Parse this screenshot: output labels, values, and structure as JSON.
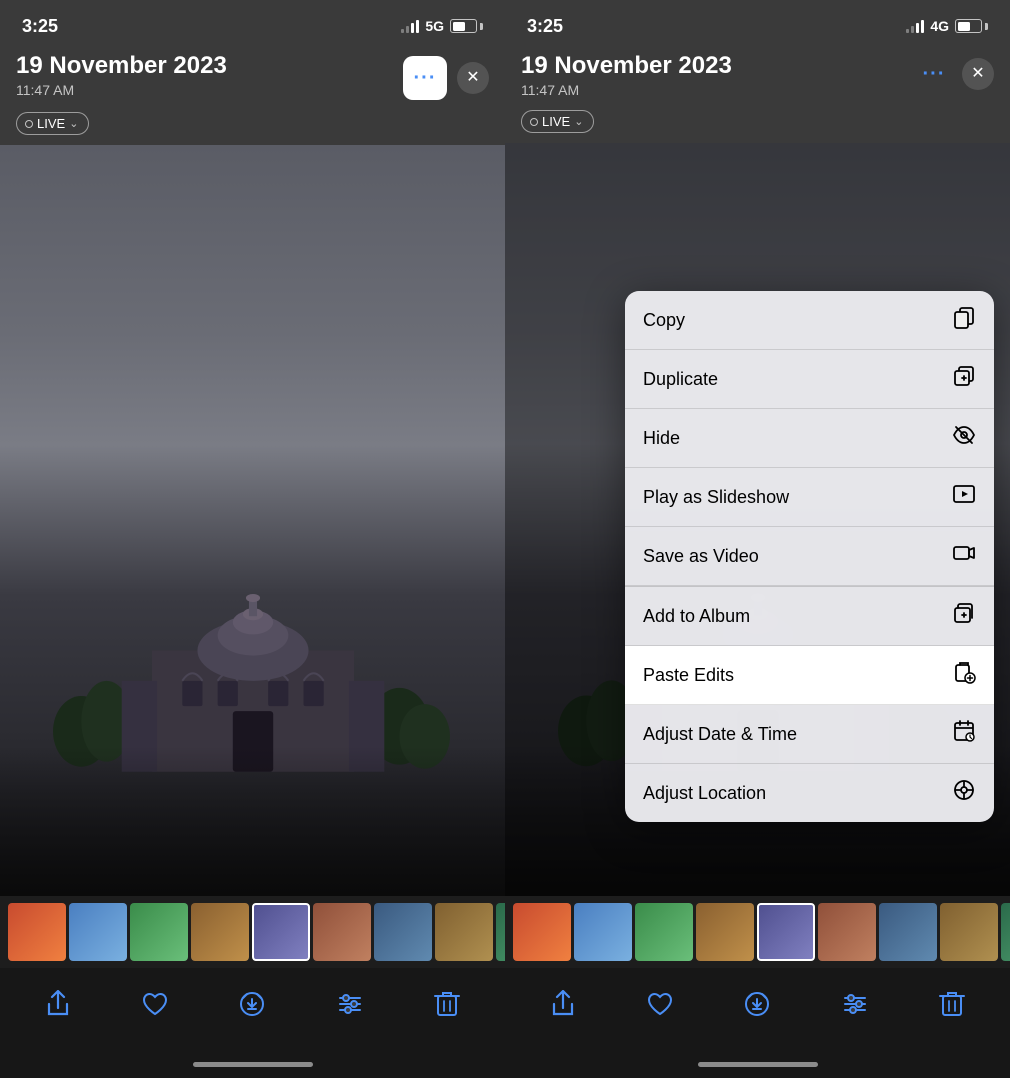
{
  "left": {
    "status": {
      "time": "3:25",
      "network": "5G",
      "signal_bars": 2,
      "battery_pct": 55
    },
    "header": {
      "date": "19 November 2023",
      "time": "11:47 AM",
      "more_label": "···",
      "close_label": "✕"
    },
    "live_badge": {
      "label": "LIVE",
      "chevron": "⌄"
    },
    "toolbar_icons": [
      "share",
      "heart",
      "download",
      "adjust",
      "trash"
    ]
  },
  "right": {
    "status": {
      "time": "3:25",
      "network": "4G",
      "signal_bars": 2,
      "battery_pct": 55
    },
    "header": {
      "date": "19 November 2023",
      "time": "11:47 AM",
      "more_label": "···",
      "close_label": "✕"
    },
    "live_badge": {
      "label": "LIVE",
      "chevron": "⌄"
    },
    "menu": {
      "items": [
        {
          "id": "copy",
          "label": "Copy",
          "icon": "copy"
        },
        {
          "id": "duplicate",
          "label": "Duplicate",
          "icon": "duplicate"
        },
        {
          "id": "hide",
          "label": "Hide",
          "icon": "hide"
        },
        {
          "id": "slideshow",
          "label": "Play as Slideshow",
          "icon": "play"
        },
        {
          "id": "save-video",
          "label": "Save as Video",
          "icon": "video"
        },
        {
          "id": "add-album",
          "label": "Add to Album",
          "icon": "album"
        },
        {
          "id": "paste-edits",
          "label": "Paste Edits",
          "icon": "paste-edits",
          "highlighted": true
        },
        {
          "id": "adjust-date",
          "label": "Adjust Date & Time",
          "icon": "calendar"
        },
        {
          "id": "adjust-location",
          "label": "Adjust Location",
          "icon": "location"
        }
      ]
    },
    "toolbar_icons": [
      "share",
      "heart",
      "download",
      "adjust",
      "trash"
    ]
  }
}
